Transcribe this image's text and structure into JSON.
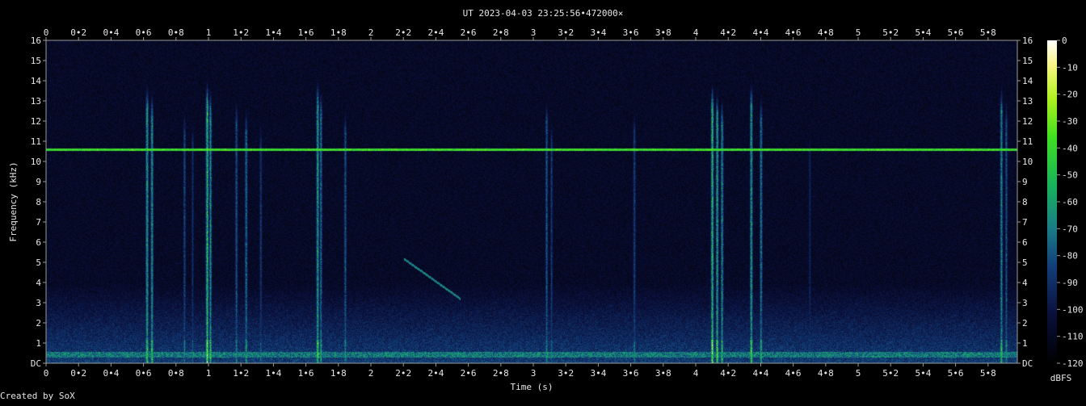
{
  "title": "UT 2023-04-03 23:25:56•472000×",
  "footer": "Created by SoX",
  "chart_data": {
    "type": "heatmap",
    "title": "UT 2023-04-03 23:25:56•472000×",
    "xlabel": "Time (s)",
    "ylabel": "Frequency (kHz)",
    "xlim": [
      0,
      5.98
    ],
    "ylim": [
      0,
      16
    ],
    "x_ticks": [
      {
        "v": 0,
        "label": "0"
      },
      {
        "v": 0.2,
        "label": "0•2"
      },
      {
        "v": 0.4,
        "label": "0•4"
      },
      {
        "v": 0.6,
        "label": "0•6"
      },
      {
        "v": 0.8,
        "label": "0•8"
      },
      {
        "v": 1,
        "label": "1"
      },
      {
        "v": 1.2,
        "label": "1•2"
      },
      {
        "v": 1.4,
        "label": "1•4"
      },
      {
        "v": 1.6,
        "label": "1•6"
      },
      {
        "v": 1.8,
        "label": "1•8"
      },
      {
        "v": 2,
        "label": "2"
      },
      {
        "v": 2.2,
        "label": "2•2"
      },
      {
        "v": 2.4,
        "label": "2•4"
      },
      {
        "v": 2.6,
        "label": "2•6"
      },
      {
        "v": 2.8,
        "label": "2•8"
      },
      {
        "v": 3,
        "label": "3"
      },
      {
        "v": 3.2,
        "label": "3•2"
      },
      {
        "v": 3.4,
        "label": "3•4"
      },
      {
        "v": 3.6,
        "label": "3•6"
      },
      {
        "v": 3.8,
        "label": "3•8"
      },
      {
        "v": 4,
        "label": "4"
      },
      {
        "v": 4.2,
        "label": "4•2"
      },
      {
        "v": 4.4,
        "label": "4•4"
      },
      {
        "v": 4.6,
        "label": "4•6"
      },
      {
        "v": 4.8,
        "label": "4•8"
      },
      {
        "v": 5,
        "label": "5"
      },
      {
        "v": 5.2,
        "label": "5•2"
      },
      {
        "v": 5.4,
        "label": "5•4"
      },
      {
        "v": 5.6,
        "label": "5•6"
      },
      {
        "v": 5.8,
        "label": "5•8"
      }
    ],
    "y_ticks": [
      {
        "v": 0,
        "label": "DC"
      },
      {
        "v": 1,
        "label": "1"
      },
      {
        "v": 2,
        "label": "2"
      },
      {
        "v": 3,
        "label": "3"
      },
      {
        "v": 4,
        "label": "4"
      },
      {
        "v": 5,
        "label": "5"
      },
      {
        "v": 6,
        "label": "6"
      },
      {
        "v": 7,
        "label": "7"
      },
      {
        "v": 8,
        "label": "8"
      },
      {
        "v": 9,
        "label": "9"
      },
      {
        "v": 10,
        "label": "10"
      },
      {
        "v": 11,
        "label": "11"
      },
      {
        "v": 12,
        "label": "12"
      },
      {
        "v": 13,
        "label": "13"
      },
      {
        "v": 14,
        "label": "14"
      },
      {
        "v": 15,
        "label": "15"
      },
      {
        "v": 16,
        "label": "16"
      }
    ],
    "colorbar": {
      "label": "dBFS",
      "range": [
        -120,
        0
      ],
      "ticks": [
        "0",
        "-10",
        "-20",
        "-30",
        "-40",
        "-50",
        "-60",
        "-70",
        "-80",
        "-90",
        "-100",
        "-110",
        "-120"
      ]
    },
    "features": {
      "tone_khz": 10.6,
      "tone_level": 0.75,
      "low_band_khz": [
        0.3,
        0.6
      ],
      "low_band_level": 0.55,
      "broadband_impulses": [
        {
          "t": 0.62,
          "fmax": 14.2,
          "level": 0.9
        },
        {
          "t": 0.65,
          "fmax": 13.8,
          "level": 0.85
        },
        {
          "t": 0.85,
          "fmax": 13.0,
          "level": 0.55
        },
        {
          "t": 0.9,
          "fmax": 12.5,
          "level": 0.45
        },
        {
          "t": 0.99,
          "fmax": 14.3,
          "level": 1.0
        },
        {
          "t": 1.01,
          "fmax": 14.0,
          "level": 0.8
        },
        {
          "t": 1.17,
          "fmax": 13.5,
          "level": 0.6
        },
        {
          "t": 1.23,
          "fmax": 13.0,
          "level": 0.7
        },
        {
          "t": 1.32,
          "fmax": 12.5,
          "level": 0.5
        },
        {
          "t": 1.67,
          "fmax": 14.4,
          "level": 0.9
        },
        {
          "t": 1.69,
          "fmax": 14.0,
          "level": 0.7
        },
        {
          "t": 1.84,
          "fmax": 13.0,
          "level": 0.6
        },
        {
          "t": 3.08,
          "fmax": 13.5,
          "level": 0.6
        },
        {
          "t": 3.11,
          "fmax": 12.5,
          "level": 0.5
        },
        {
          "t": 3.62,
          "fmax": 13.0,
          "level": 0.55
        },
        {
          "t": 4.1,
          "fmax": 14.2,
          "level": 1.0
        },
        {
          "t": 4.13,
          "fmax": 13.8,
          "level": 0.9
        },
        {
          "t": 4.16,
          "fmax": 13.5,
          "level": 0.8
        },
        {
          "t": 4.34,
          "fmax": 14.3,
          "level": 0.9
        },
        {
          "t": 4.4,
          "fmax": 13.6,
          "level": 0.75
        },
        {
          "t": 4.7,
          "fmax": 12.0,
          "level": 0.4
        },
        {
          "t": 5.88,
          "fmax": 14.1,
          "level": 0.8
        },
        {
          "t": 5.91,
          "fmax": 13.5,
          "level": 0.6
        }
      ],
      "chirp": {
        "t0": 2.2,
        "f0": 5.2,
        "t1": 2.55,
        "f1": 3.2
      }
    }
  }
}
